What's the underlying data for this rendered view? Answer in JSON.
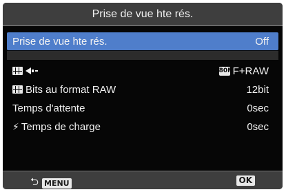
{
  "title": "Prise de vue hte rés.",
  "rows": [
    {
      "label": "Prise de vue hte rés.",
      "value": "Off"
    },
    {
      "label": "",
      "value": "F+RAW",
      "quality_badge": "80M"
    },
    {
      "label": "Bits au format RAW",
      "value": "12bit"
    },
    {
      "label": "Temps d'attente",
      "value": "0sec"
    },
    {
      "label": "Temps de charge",
      "value": "0sec"
    }
  ],
  "footer": {
    "menu_label": "MENU",
    "ok_label": "OK"
  },
  "icons": {
    "row1_left": "image-quality-icon",
    "row2_left": "image-quality-icon",
    "row4_left": "flash-icon",
    "footer_back": "back-arrow-icon"
  },
  "colors": {
    "background": "#060606",
    "title_bar": "#3e3e3e",
    "selection": "#4f7ecb"
  }
}
